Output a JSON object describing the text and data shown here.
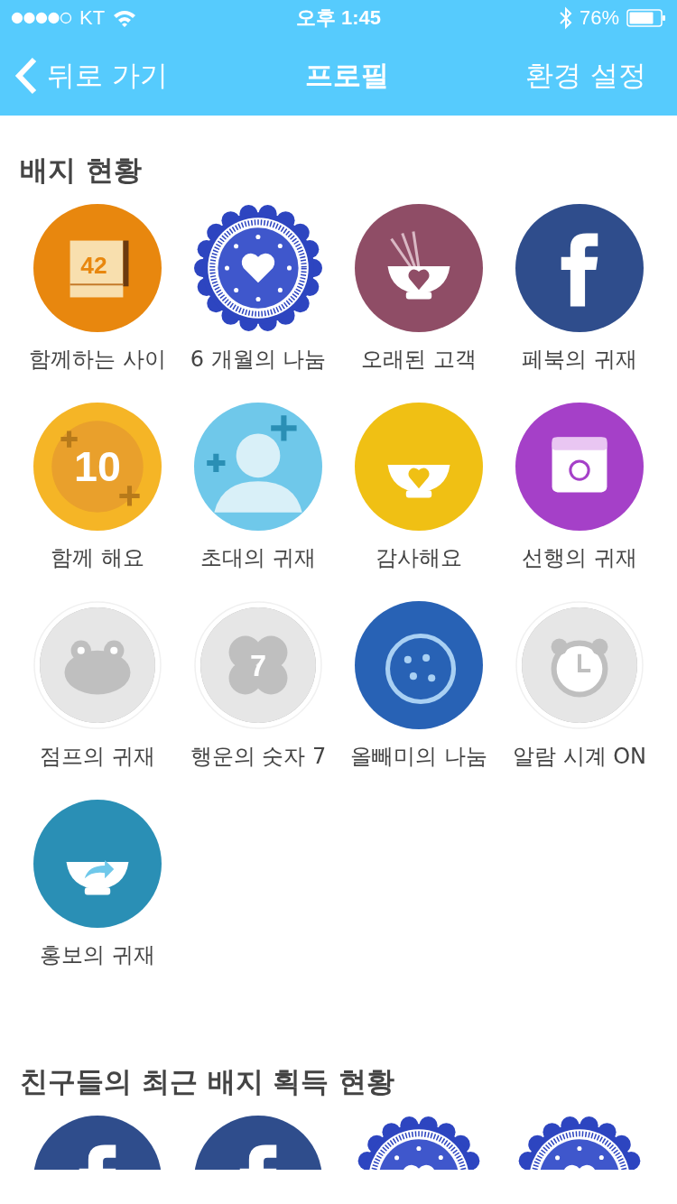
{
  "status_bar": {
    "carrier": "KT",
    "time": "오후 1:45",
    "battery": "76%"
  },
  "nav": {
    "back": "뒤로 가기",
    "title": "프로필",
    "settings": "환경 설정"
  },
  "badges_section": {
    "title": "배지 현황",
    "badges": [
      {
        "kind": "calendar",
        "label": "함께하는 사이",
        "number": "42",
        "earned": true
      },
      {
        "kind": "seal",
        "label": "6 개월의 나눔",
        "earned": true
      },
      {
        "kind": "wheat-bowl",
        "label": "오래된 고객",
        "earned": true
      },
      {
        "kind": "facebook",
        "label": "페북의 귀재",
        "earned": true
      },
      {
        "kind": "ten",
        "label": "함께 해요",
        "number": "10",
        "earned": true
      },
      {
        "kind": "invite",
        "label": "초대의 귀재",
        "earned": true
      },
      {
        "kind": "heart-bowl",
        "label": "감사해요",
        "earned": true
      },
      {
        "kind": "planner",
        "label": "선행의 귀재",
        "earned": true
      },
      {
        "kind": "frog",
        "label": "점프의 귀재",
        "earned": false
      },
      {
        "kind": "clover",
        "label": "행운의 숫자 7",
        "number": "7",
        "earned": false
      },
      {
        "kind": "cookie",
        "label": "올빼미의 나눔",
        "earned": true
      },
      {
        "kind": "alarm",
        "label": "알람 시계 ON",
        "earned": false
      },
      {
        "kind": "share-bowl",
        "label": "홍보의 귀재",
        "earned": true
      }
    ]
  },
  "friends_section": {
    "title": "친구들의 최근 배지 획득 현황",
    "badges": [
      {
        "kind": "facebook",
        "earned": true
      },
      {
        "kind": "facebook",
        "earned": true
      },
      {
        "kind": "seal",
        "earned": true
      },
      {
        "kind": "seal",
        "earned": true
      }
    ]
  }
}
